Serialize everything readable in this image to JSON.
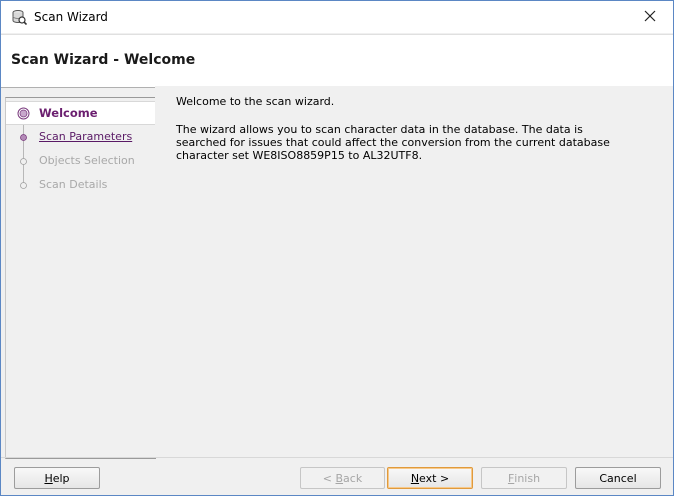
{
  "window": {
    "title": "Scan Wizard"
  },
  "header": {
    "title": "Scan Wizard - Welcome"
  },
  "nav": {
    "items": [
      {
        "label": "Welcome",
        "state": "active"
      },
      {
        "label": "Scan Parameters",
        "state": "link"
      },
      {
        "label": "Objects Selection",
        "state": "disabled"
      },
      {
        "label": "Scan Details",
        "state": "disabled"
      }
    ]
  },
  "content": {
    "intro": "Welcome to the scan wizard.",
    "description": "The wizard allows you to scan character data in the database. The data is searched for issues that could affect the conversion from the current database character set WE8ISO8859P15 to AL32UTF8."
  },
  "buttons": {
    "help": {
      "prefix": "",
      "mnemonic": "H",
      "suffix": "elp"
    },
    "back": {
      "prefix": "< ",
      "mnemonic": "B",
      "suffix": "ack"
    },
    "next": {
      "prefix": "",
      "mnemonic": "N",
      "suffix": "ext >"
    },
    "finish": {
      "prefix": "",
      "mnemonic": "F",
      "suffix": "inish"
    },
    "cancel": {
      "prefix": "",
      "mnemonic": "",
      "suffix": "Cancel"
    }
  },
  "colors": {
    "accent_purple": "#6b1f6f",
    "default_button_border": "#e09a3c",
    "window_border": "#5b87c4"
  },
  "icons": {
    "app": "scan-wizard-icon",
    "close": "close-icon",
    "step_current": "current-step-icon",
    "step_pending": "step-icon"
  }
}
